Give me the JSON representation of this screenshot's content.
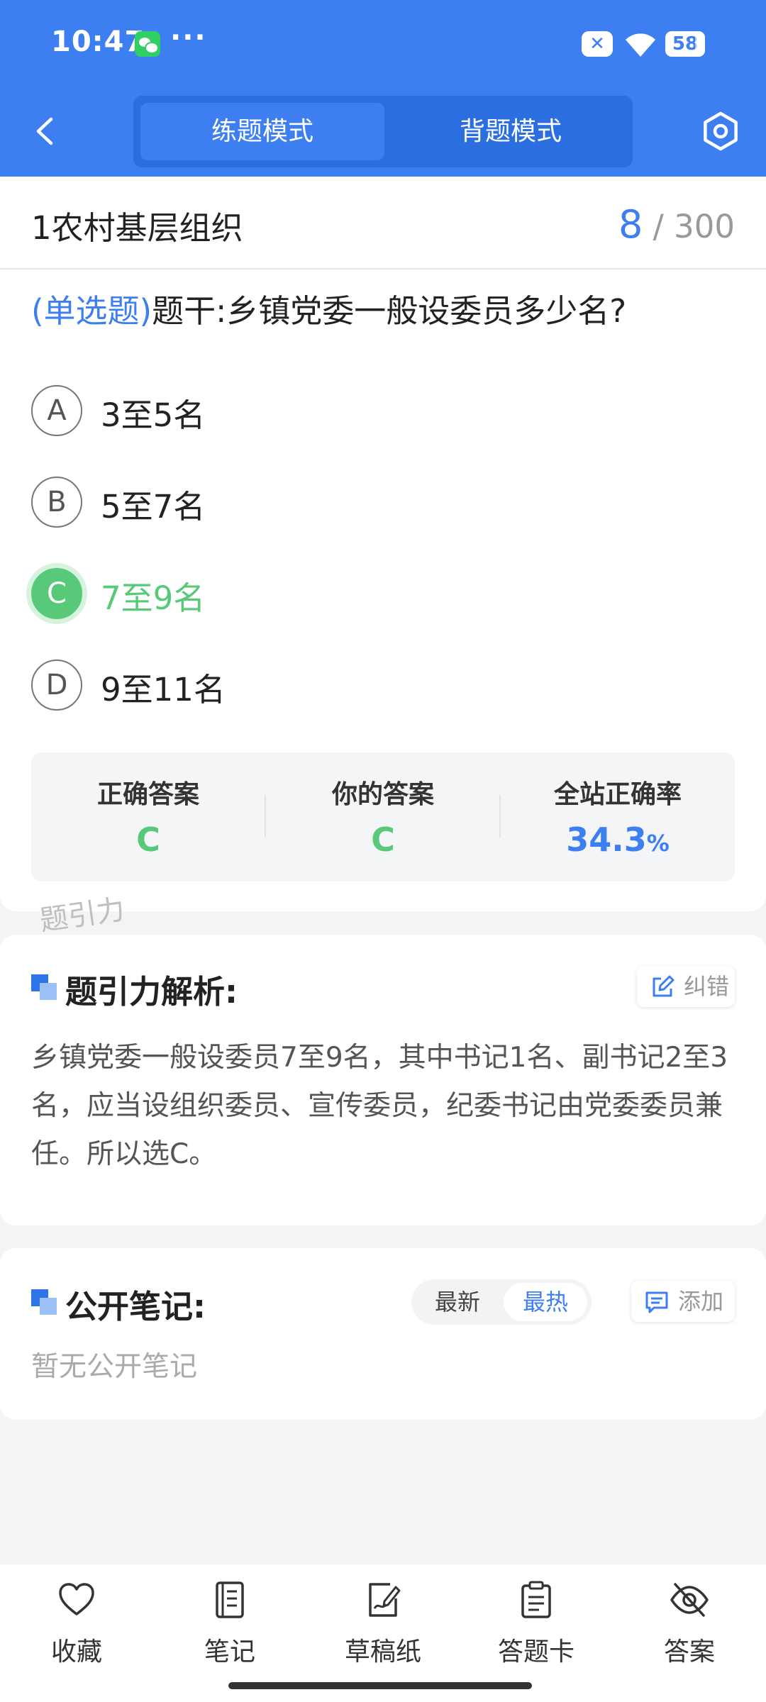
{
  "status_bar": {
    "time": "10:47",
    "more": "···",
    "battery": "58"
  },
  "header": {
    "tabs": [
      "练题模式",
      "背题模式"
    ],
    "active_tab": 0
  },
  "chapter": {
    "title": "1农村基层组织",
    "current": "8",
    "total": "/ 300"
  },
  "question": {
    "type": "(单选题)",
    "stem": "题干:乡镇党委一般设委员多少名?",
    "options": [
      {
        "letter": "A",
        "text": "3至5名",
        "state": "normal"
      },
      {
        "letter": "B",
        "text": "5至7名",
        "state": "normal"
      },
      {
        "letter": "C",
        "text": "7至9名",
        "state": "correct"
      },
      {
        "letter": "D",
        "text": "9至11名",
        "state": "normal"
      }
    ]
  },
  "answer_summary": {
    "correct_label": "正确答案",
    "correct_value": "C",
    "yours_label": "你的答案",
    "yours_value": "C",
    "rate_label": "全站正确率",
    "rate_value": "34.3",
    "rate_unit": "%"
  },
  "watermark": "题引力",
  "analysis": {
    "title": "题引力解析:",
    "report_label": "纠错",
    "text": "乡镇党委一般设委员7至9名，其中书记1名、副书记2至3名，应当设组织委员、宣传委员，纪委书记由党委委员兼任。所以选C。"
  },
  "notes": {
    "title": "公开笔记:",
    "sort_options": [
      "最新",
      "最热"
    ],
    "active_sort": 1,
    "add_label": "添加",
    "empty_text": "暂无公开笔记"
  },
  "bottom_nav": [
    {
      "label": "收藏",
      "icon": "heart-icon"
    },
    {
      "label": "笔记",
      "icon": "notebook-icon"
    },
    {
      "label": "草稿纸",
      "icon": "draft-paper-icon"
    },
    {
      "label": "答题卡",
      "icon": "answer-sheet-icon"
    },
    {
      "label": "答案",
      "icon": "eye-off-icon"
    }
  ],
  "colors": {
    "primary": "#3d7ff0",
    "correct": "#57c978",
    "background": "#f3f4f6"
  }
}
